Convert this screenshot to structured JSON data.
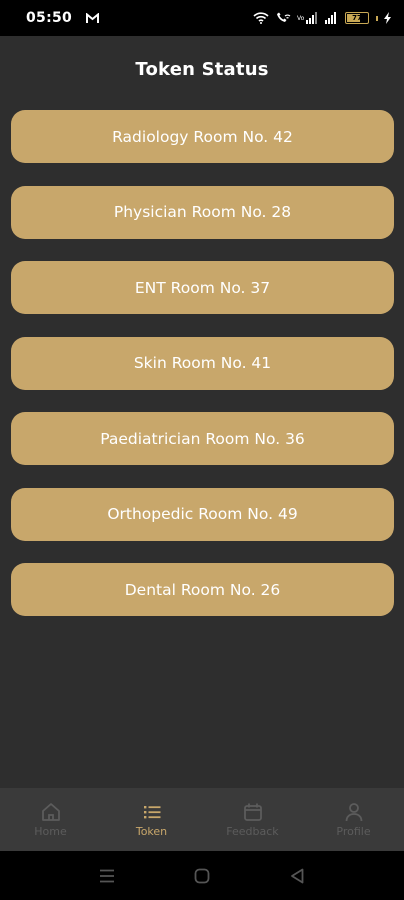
{
  "status_bar": {
    "time": "05:50",
    "notification_icon": "gmail-icon",
    "battery_level": "77",
    "icons": [
      "wifi-icon",
      "wifi-call-icon",
      "signal-icon",
      "signal-icon",
      "battery-icon",
      "charging-icon"
    ]
  },
  "header": {
    "title": "Token Status"
  },
  "rooms": [
    {
      "label": "Radiology Room No. 42"
    },
    {
      "label": "Physician Room No. 28"
    },
    {
      "label": "ENT Room No. 37"
    },
    {
      "label": "Skin Room No. 41"
    },
    {
      "label": "Paediatrician Room No. 36"
    },
    {
      "label": "Orthopedic Room No. 49"
    },
    {
      "label": "Dental Room No. 26"
    }
  ],
  "bottom_nav": {
    "items": [
      {
        "label": "Home",
        "icon": "home-icon",
        "active": false
      },
      {
        "label": "Token",
        "icon": "list-icon",
        "active": true
      },
      {
        "label": "Feedback",
        "icon": "calendar-icon",
        "active": false
      },
      {
        "label": "Profile",
        "icon": "person-icon",
        "active": false
      }
    ]
  },
  "system_nav": {
    "buttons": [
      "recents-icon",
      "home-circle-icon",
      "back-icon"
    ]
  },
  "colors": {
    "background": "#2e2e2e",
    "accent": "#c8a76b",
    "nav_background": "#3a3a3a",
    "inactive": "#5c5c5c"
  }
}
